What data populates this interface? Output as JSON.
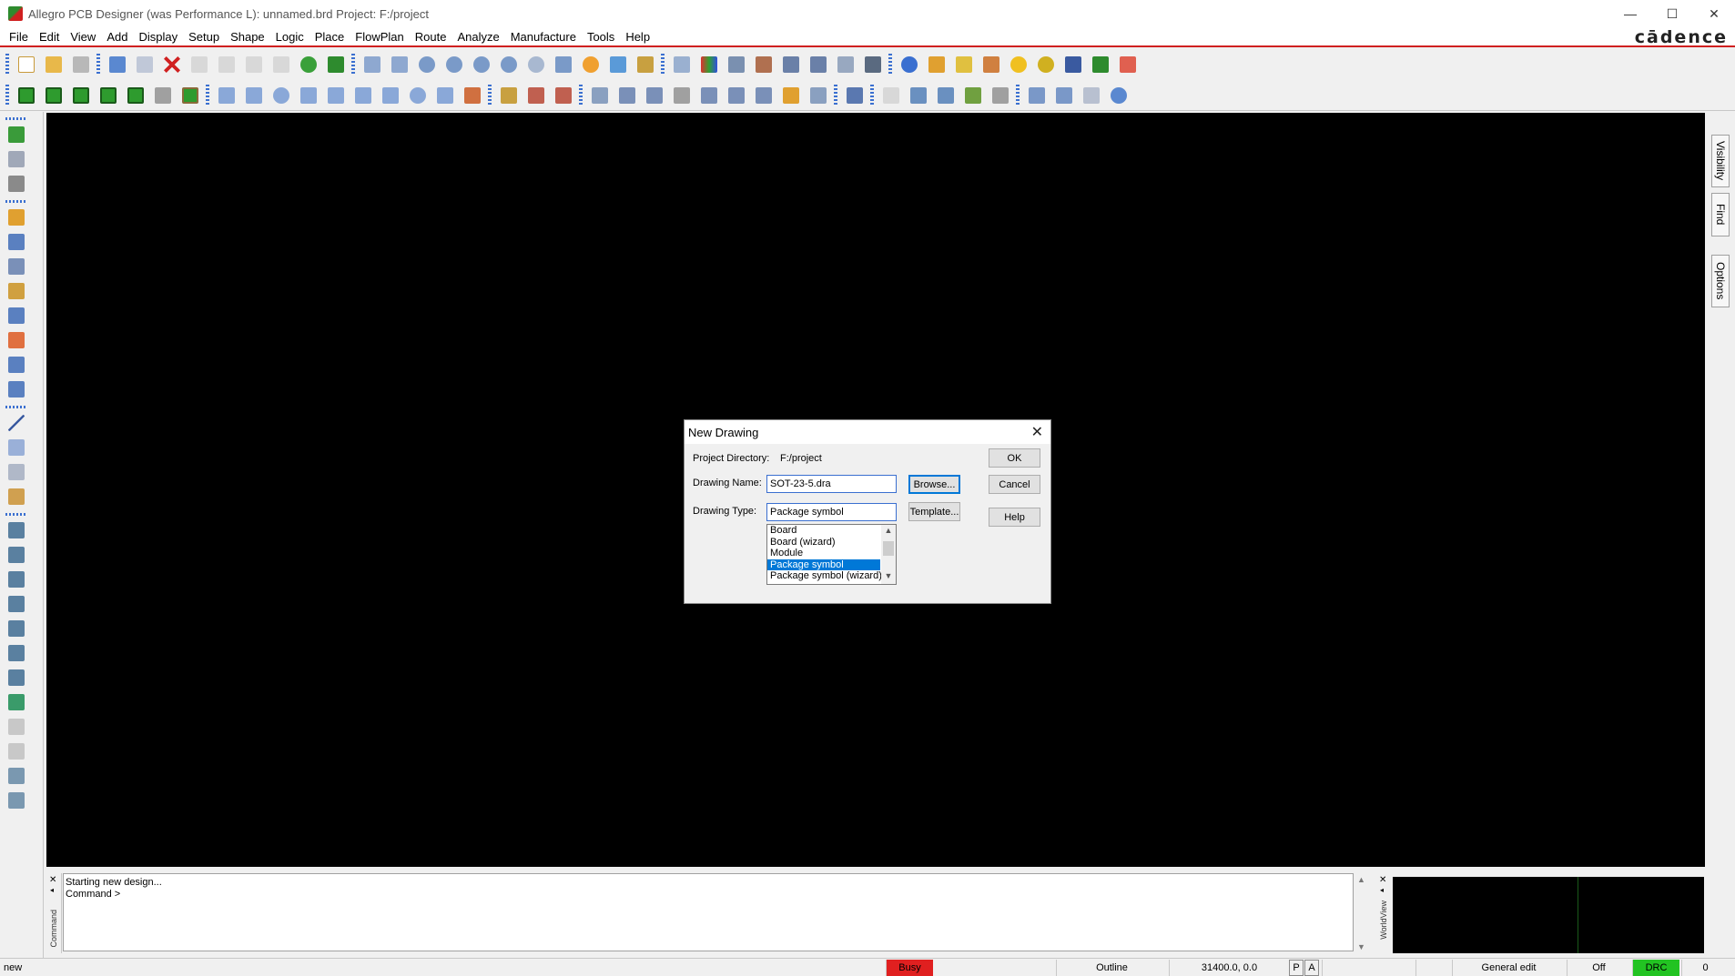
{
  "window": {
    "title": "Allegro PCB Designer (was Performance L): unnamed.brd  Project: F:/project",
    "minimize": "—",
    "maximize": "☐",
    "close": "✕"
  },
  "menu": {
    "items": [
      "File",
      "Edit",
      "View",
      "Add",
      "Display",
      "Setup",
      "Shape",
      "Logic",
      "Place",
      "FlowPlan",
      "Route",
      "Analyze",
      "Manufacture",
      "Tools",
      "Help"
    ],
    "brand": "cādence"
  },
  "right_tabs": [
    "Visibility",
    "Find",
    "Options"
  ],
  "dialog": {
    "title": "New Drawing",
    "close": "✕",
    "project_directory_label": "Project Directory:",
    "project_directory_value": "F:/project",
    "drawing_name_label": "Drawing Name:",
    "drawing_name_value": "SOT-23-5.dra",
    "drawing_type_label": "Drawing Type:",
    "drawing_type_value": "Package symbol",
    "browse_label": "Browse...",
    "template_label": "Template...",
    "ok_label": "OK",
    "cancel_label": "Cancel",
    "help_label": "Help",
    "type_options": [
      "Board",
      "Board (wizard)",
      "Module",
      "Package symbol",
      "Package symbol (wizard)"
    ],
    "selected_index": 3
  },
  "console": {
    "lines": [
      "Starting new design...",
      "Command >"
    ],
    "side_label": "Command",
    "worldview_label": "WorldView"
  },
  "status": {
    "mode": "new",
    "busy": "Busy",
    "subclass": "Outline",
    "coords": "31400.0, 0.0",
    "p_flag": "P",
    "a_flag": "A",
    "edit_mode": "General edit",
    "off": "Off",
    "drc": "DRC",
    "drc_count": "0"
  },
  "colors": {
    "busy": "#e02020",
    "drc": "#22c322",
    "selection": "#0078d7",
    "accent_line": "#d02020"
  }
}
